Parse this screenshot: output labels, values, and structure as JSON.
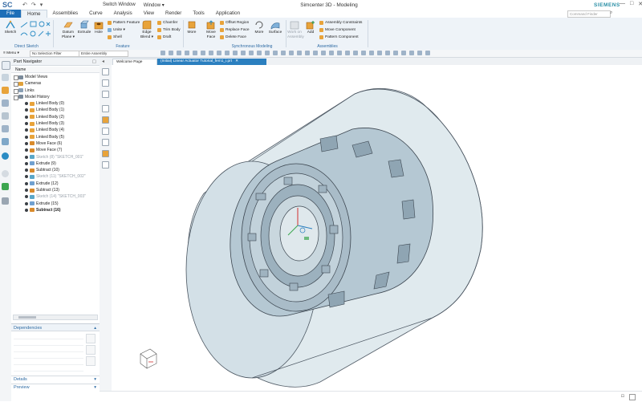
{
  "titlebar": {
    "logo": "SC",
    "quick_access": [
      "↶",
      "↷",
      "▾"
    ],
    "switch_window": "Switch Window",
    "window_menu": "Window ▾",
    "title": "Simcenter 3D - Modeling",
    "brand": "SIEMENS",
    "window_controls": [
      "—",
      "□",
      "✕"
    ]
  },
  "tabs": [
    {
      "label": "File"
    },
    {
      "label": "Home"
    },
    {
      "label": "Assemblies"
    },
    {
      "label": "Curve"
    },
    {
      "label": "Analysis"
    },
    {
      "label": "View"
    },
    {
      "label": "Render"
    },
    {
      "label": "Tools"
    },
    {
      "label": "Application"
    }
  ],
  "search": {
    "placeholder": "Command Finder"
  },
  "ribbon": {
    "direct_sketch": {
      "sketch": "Sketch",
      "label": "Direct Sketch"
    },
    "feature": {
      "datum_plane": "Datum Plane ▾",
      "extrude": "Extrude",
      "hole": "Hole",
      "pattern_feature": "Pattern Feature",
      "unite": "Unite ▾",
      "shell": "Shell",
      "edge_blend": "Edge Blend ▾",
      "chamfer": "Chamfer",
      "trim_body": "Trim Body",
      "draft": "Draft",
      "more": "More",
      "label": "Feature"
    },
    "sync": {
      "move_face": "Move Face",
      "offset_region": "Offset Region",
      "replace_face": "Replace Face",
      "delete_face": "Delete Face",
      "more": "More",
      "surface": "Surface",
      "label": "Synchronous Modeling"
    },
    "assemblies": {
      "work_on_assembly": "Work on Assembly",
      "add": "Add",
      "assembly_constraints": "Assembly Constraints",
      "move_component": "Move Component",
      "pattern_component": "Pattern Component",
      "label": "Assemblies"
    }
  },
  "toolbar2": {
    "menu": "≡ Menu ▾",
    "selection_filter": "No Selection Filter",
    "scope": "Entire Assembly"
  },
  "part_navigator": {
    "title": "Part Navigator",
    "column": "Name",
    "items": [
      {
        "label": "Model Views",
        "indent": 1,
        "style": "normal",
        "icon": "#7a8a9a"
      },
      {
        "label": "Cameras",
        "indent": 1,
        "style": "normal",
        "icon": "#e0a13a"
      },
      {
        "label": "Links",
        "indent": 1,
        "style": "normal",
        "icon": "#8aa0b5"
      },
      {
        "label": "Model History",
        "indent": 1,
        "style": "normal",
        "icon": "#7a8a9a"
      },
      {
        "label": "Linked Body (0)",
        "indent": 2,
        "style": "normal",
        "icon": "#e8a33a"
      },
      {
        "label": "Linked Body (1)",
        "indent": 2,
        "style": "normal",
        "icon": "#e8a33a"
      },
      {
        "label": "Linked Body (2)",
        "indent": 2,
        "style": "normal",
        "icon": "#e8a33a"
      },
      {
        "label": "Linked Body (3)",
        "indent": 2,
        "style": "normal",
        "icon": "#e8a33a"
      },
      {
        "label": "Linked Body (4)",
        "indent": 2,
        "style": "normal",
        "icon": "#e8a33a"
      },
      {
        "label": "Linked Body (5)",
        "indent": 2,
        "style": "normal",
        "icon": "#e8a33a"
      },
      {
        "label": "Move Face (6)",
        "indent": 2,
        "style": "normal",
        "icon": "#d98a2b"
      },
      {
        "label": "Move Face (7)",
        "indent": 2,
        "style": "normal",
        "icon": "#d98a2b"
      },
      {
        "label": "Sketch (8) \"SKETCH_001\"",
        "indent": 2,
        "style": "grey",
        "icon": "#5aa7c8"
      },
      {
        "label": "Extrude (9)",
        "indent": 2,
        "style": "normal",
        "icon": "#6fa0d0"
      },
      {
        "label": "Subtract (10)",
        "indent": 2,
        "style": "normal",
        "icon": "#d98a2b"
      },
      {
        "label": "Sketch (11) \"SKETCH_002\"",
        "indent": 2,
        "style": "grey",
        "icon": "#5aa7c8"
      },
      {
        "label": "Extrude (12)",
        "indent": 2,
        "style": "normal",
        "icon": "#6fa0d0"
      },
      {
        "label": "Subtract (13)",
        "indent": 2,
        "style": "normal",
        "icon": "#d98a2b"
      },
      {
        "label": "Sketch (14) \"SKETCH_003\"",
        "indent": 2,
        "style": "grey",
        "icon": "#5aa7c8"
      },
      {
        "label": "Extrude (15)",
        "indent": 2,
        "style": "normal",
        "icon": "#6fa0d0"
      },
      {
        "label": "Subtract (16)",
        "indent": 2,
        "style": "bold",
        "icon": "#d98a2b"
      }
    ]
  },
  "dependencies": {
    "title": "Dependencies"
  },
  "details": {
    "title": "Details"
  },
  "preview": {
    "title": "Preview"
  },
  "doc_tabs": {
    "welcome": "Welcome Page",
    "part": "(Initial) Linear Actuator Tutorial_fem1_i.prt",
    "close": "✕"
  },
  "status": {
    "right": "⊡"
  },
  "colors": {
    "accent": "#1e6fb8",
    "brand": "#2a8fa6",
    "model_face": "#a9bcc8",
    "model_edge": "#3c4650"
  }
}
